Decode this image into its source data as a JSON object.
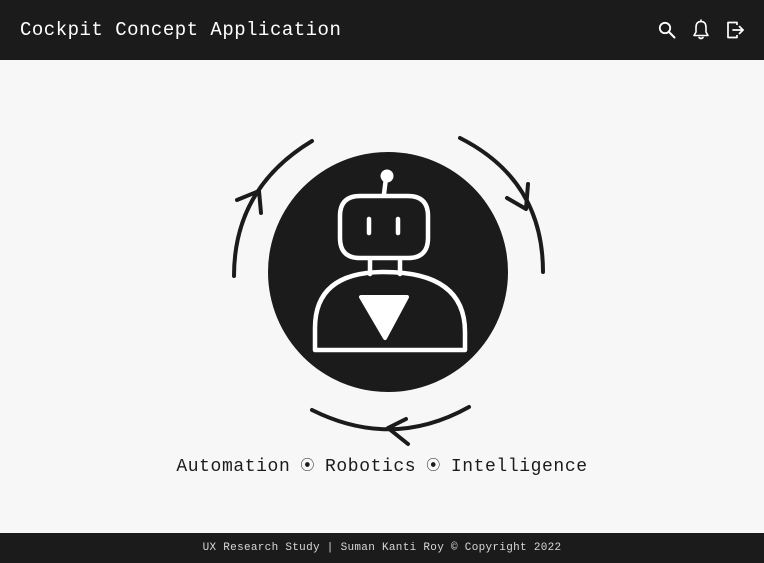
{
  "header": {
    "title": "Cockpit Concept Application",
    "actions": [
      {
        "icon": "search-icon"
      },
      {
        "icon": "bell-icon"
      },
      {
        "icon": "logout-icon"
      }
    ]
  },
  "hero": {
    "illustration": "robot-cycle-icon",
    "tagline": {
      "items": [
        "Automation",
        "Robotics",
        "Intelligence"
      ],
      "separator": "⦿"
    }
  },
  "footer": {
    "text": "UX Research Study | Suman Kanti Roy © Copyright 2022"
  },
  "colors": {
    "bar": "#1b1b1b",
    "background": "#f7f7f7",
    "text_light": "#ffffff"
  }
}
